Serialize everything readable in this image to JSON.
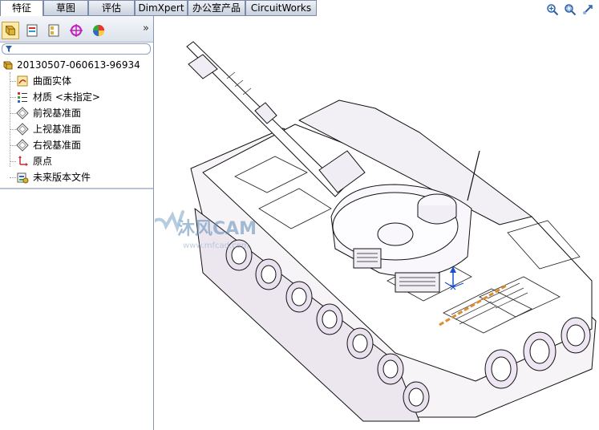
{
  "tabs": [
    {
      "label": "特征",
      "active": true
    },
    {
      "label": "草图",
      "active": false
    },
    {
      "label": "评估",
      "active": false
    },
    {
      "label": "DimXpert",
      "active": false
    },
    {
      "label": "办公室产品",
      "active": false
    },
    {
      "label": "CircuitWorks",
      "active": false
    }
  ],
  "toolbar": {
    "expand_label": "»"
  },
  "tree": {
    "root": "20130507-060613-96934",
    "items": [
      {
        "label": "曲面实体",
        "icon": "surface-body-icon"
      },
      {
        "label": "材质 <未指定>",
        "icon": "material-icon"
      },
      {
        "label": "前视基准面",
        "icon": "plane-icon"
      },
      {
        "label": "上视基准面",
        "icon": "plane-icon"
      },
      {
        "label": "右视基准面",
        "icon": "plane-icon"
      },
      {
        "label": "原点",
        "icon": "origin-icon"
      },
      {
        "label": "未来版本文件",
        "icon": "future-version-icon"
      }
    ]
  },
  "watermark": {
    "text": "沐风CAM",
    "subtext": "www.mfcad.com"
  },
  "colors": {
    "tab_border": "#7a8aa8",
    "panel_bg": "#ffffff",
    "accent": "#ffe9a8"
  }
}
